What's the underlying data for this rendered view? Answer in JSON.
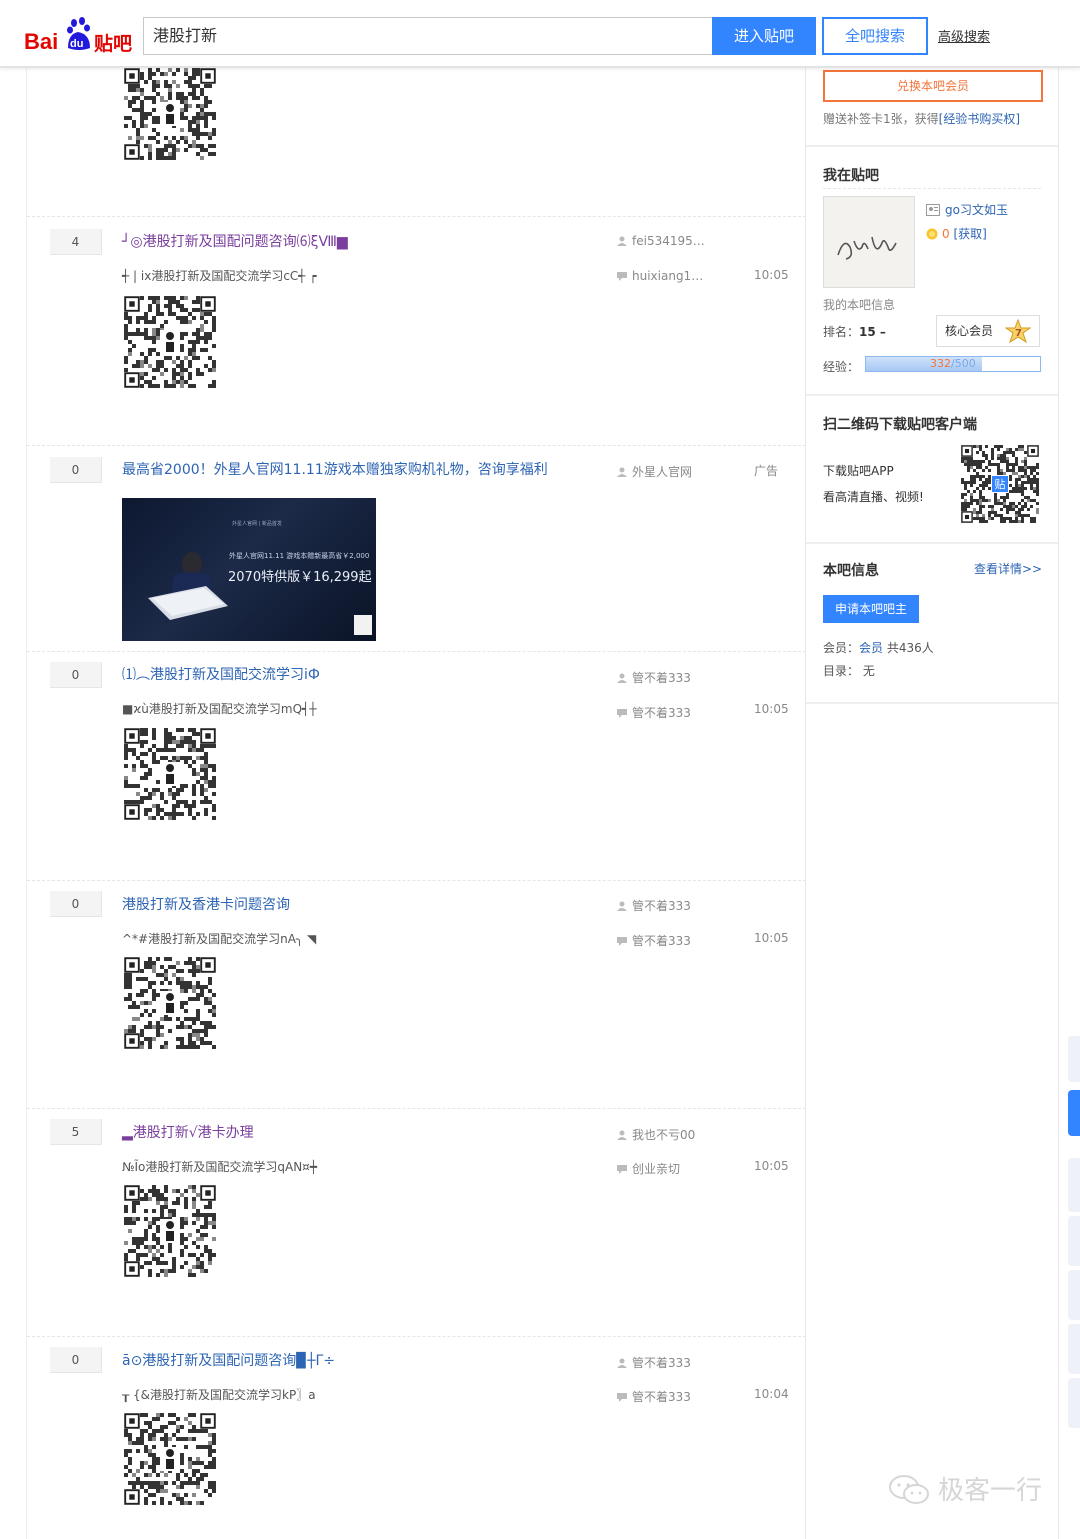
{
  "header": {
    "logo_text_1": "Bai",
    "logo_text_2": "du",
    "logo_text_3": "贴吧",
    "search_value": "港股打新",
    "enter_button": "进入贴吧",
    "all_search_button": "全吧搜索",
    "advanced_search": "高级搜索"
  },
  "threads": [
    {
      "replies": "4",
      "title": "┘◎港股打新及国配问题咨询⑹ξⅧ▆",
      "abstract": "┽ | ix港股打新及国配交流学习cC┽ ┍",
      "author": "fei534195…",
      "last_reply": "huixiang1…",
      "time": "10:05"
    },
    {
      "replies": "0",
      "title": "最高省2000！外星人官网11.11游戏本赠独家购机礼物，咨询享福利",
      "author": "外星人官网",
      "time": "广告",
      "ad_line1": "外星人官网11.11 游戏本赠新最高省￥2,000",
      "ad_line2": "2070特供版￥16,299起",
      "ad_line3": "外星人官网 | 新品首发"
    },
    {
      "replies": "0",
      "title": "⑴︵港股打新及国配交流学习iФ",
      "abstract": "■ϰù港股打新及国配交流学习mQ┥┼",
      "author": "管不着333",
      "last_reply": "管不着333",
      "time": "10:05"
    },
    {
      "replies": "0",
      "title": "港股打新及香港卡问题咨询",
      "abstract": "^*#港股打新及国配交流学习nA╮ ◥",
      "author": "管不着333",
      "last_reply": "管不着333",
      "time": "10:05"
    },
    {
      "replies": "5",
      "title": "▂港股打新√港卡办理",
      "abstract": "№Ĩo港股打新及国配交流学习qAN¤┿",
      "author": "我也不亏00",
      "last_reply": "创业亲切",
      "time": "10:05"
    },
    {
      "replies": "0",
      "title": "ā⊙港股打新及国配问题咨询▉┼Γ÷",
      "abstract": "┰ {&港股打新及国配交流学习kP〗a",
      "author": "管不着333",
      "last_reply": "管不着333",
      "time": "10:04"
    }
  ],
  "sidebar": {
    "exchange_button": "兑换本吧会员",
    "exchange_tip_prefix": "赠送补签卡1张，获得",
    "exchange_tip_link": "[经验书购买权]",
    "my_tieba_title": "我在贴吧",
    "username": "go习文如玉",
    "coins_count": "0",
    "coins_get": "[获取]",
    "my_info_label": "我的本吧信息",
    "rank_label": "排名：",
    "rank_value": "15 –",
    "member_badge": "核心会员",
    "member_level": "7",
    "exp_label": "经验：",
    "exp_current": "332",
    "exp_total": "/500",
    "exp_fraction": 0.664,
    "app_title": "扫二维码下载贴吧客户端",
    "app_line1": "下载贴吧APP",
    "app_line2": "看高清直播、视频!",
    "app_qr_badge": "贴",
    "bar_info_title": "本吧信息",
    "details_link": "查看详情>>",
    "apply_button": "申请本吧吧主",
    "member_label": "会员：",
    "member_link": "会员",
    "member_count": "共436人",
    "dir_label": "目录：",
    "dir_value": "无"
  },
  "watermark": "极客一行",
  "colors": {
    "accent": "#3385ff",
    "link": "#2d64b3",
    "visited": "#7a3e9d",
    "orange": "#f3753a"
  }
}
